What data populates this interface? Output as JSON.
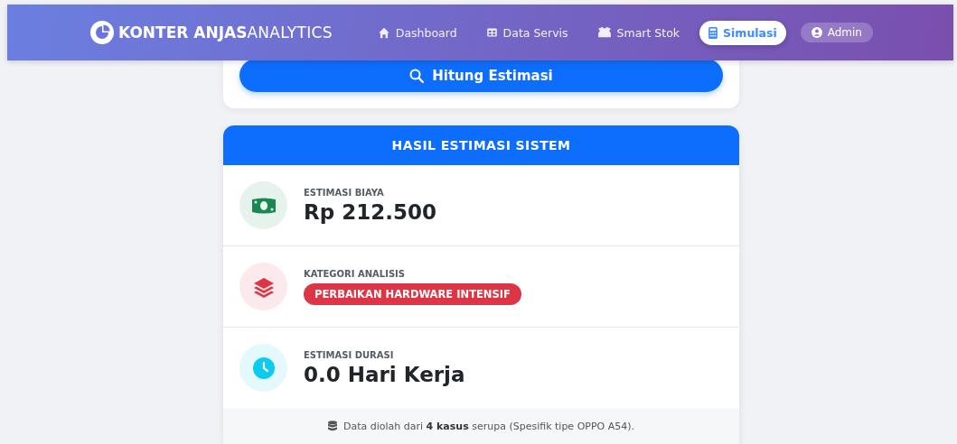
{
  "brand": {
    "bold": "KONTER ANJAS",
    "light": "ANALYTICS"
  },
  "nav": [
    {
      "label": "Dashboard",
      "selected": false
    },
    {
      "label": "Data Servis",
      "selected": false
    },
    {
      "label": "Smart Stok",
      "selected": false
    },
    {
      "label": "Simulasi",
      "selected": true
    }
  ],
  "user": {
    "label": "Admin"
  },
  "action_button": {
    "label": "Hitung Estimasi"
  },
  "result": {
    "title": "HASIL ESTIMASI SISTEM",
    "items": [
      {
        "kind": "amount",
        "color": "#198754",
        "label": "ESTIMASI BIAYA",
        "value": "Rp 212.500"
      },
      {
        "kind": "badge",
        "color": "#dc3545",
        "label": "KATEGORI ANALISIS",
        "value": "PERBAIKAN HARDWARE INTENSIF"
      },
      {
        "kind": "amount",
        "color": "#0dcaf0",
        "label": "ESTIMASI DURASI",
        "value": "0.0 Hari Kerja"
      }
    ],
    "note": "Data diolah dari **4 kasus** serupa (Spesifik tipe OPPO A54)."
  }
}
